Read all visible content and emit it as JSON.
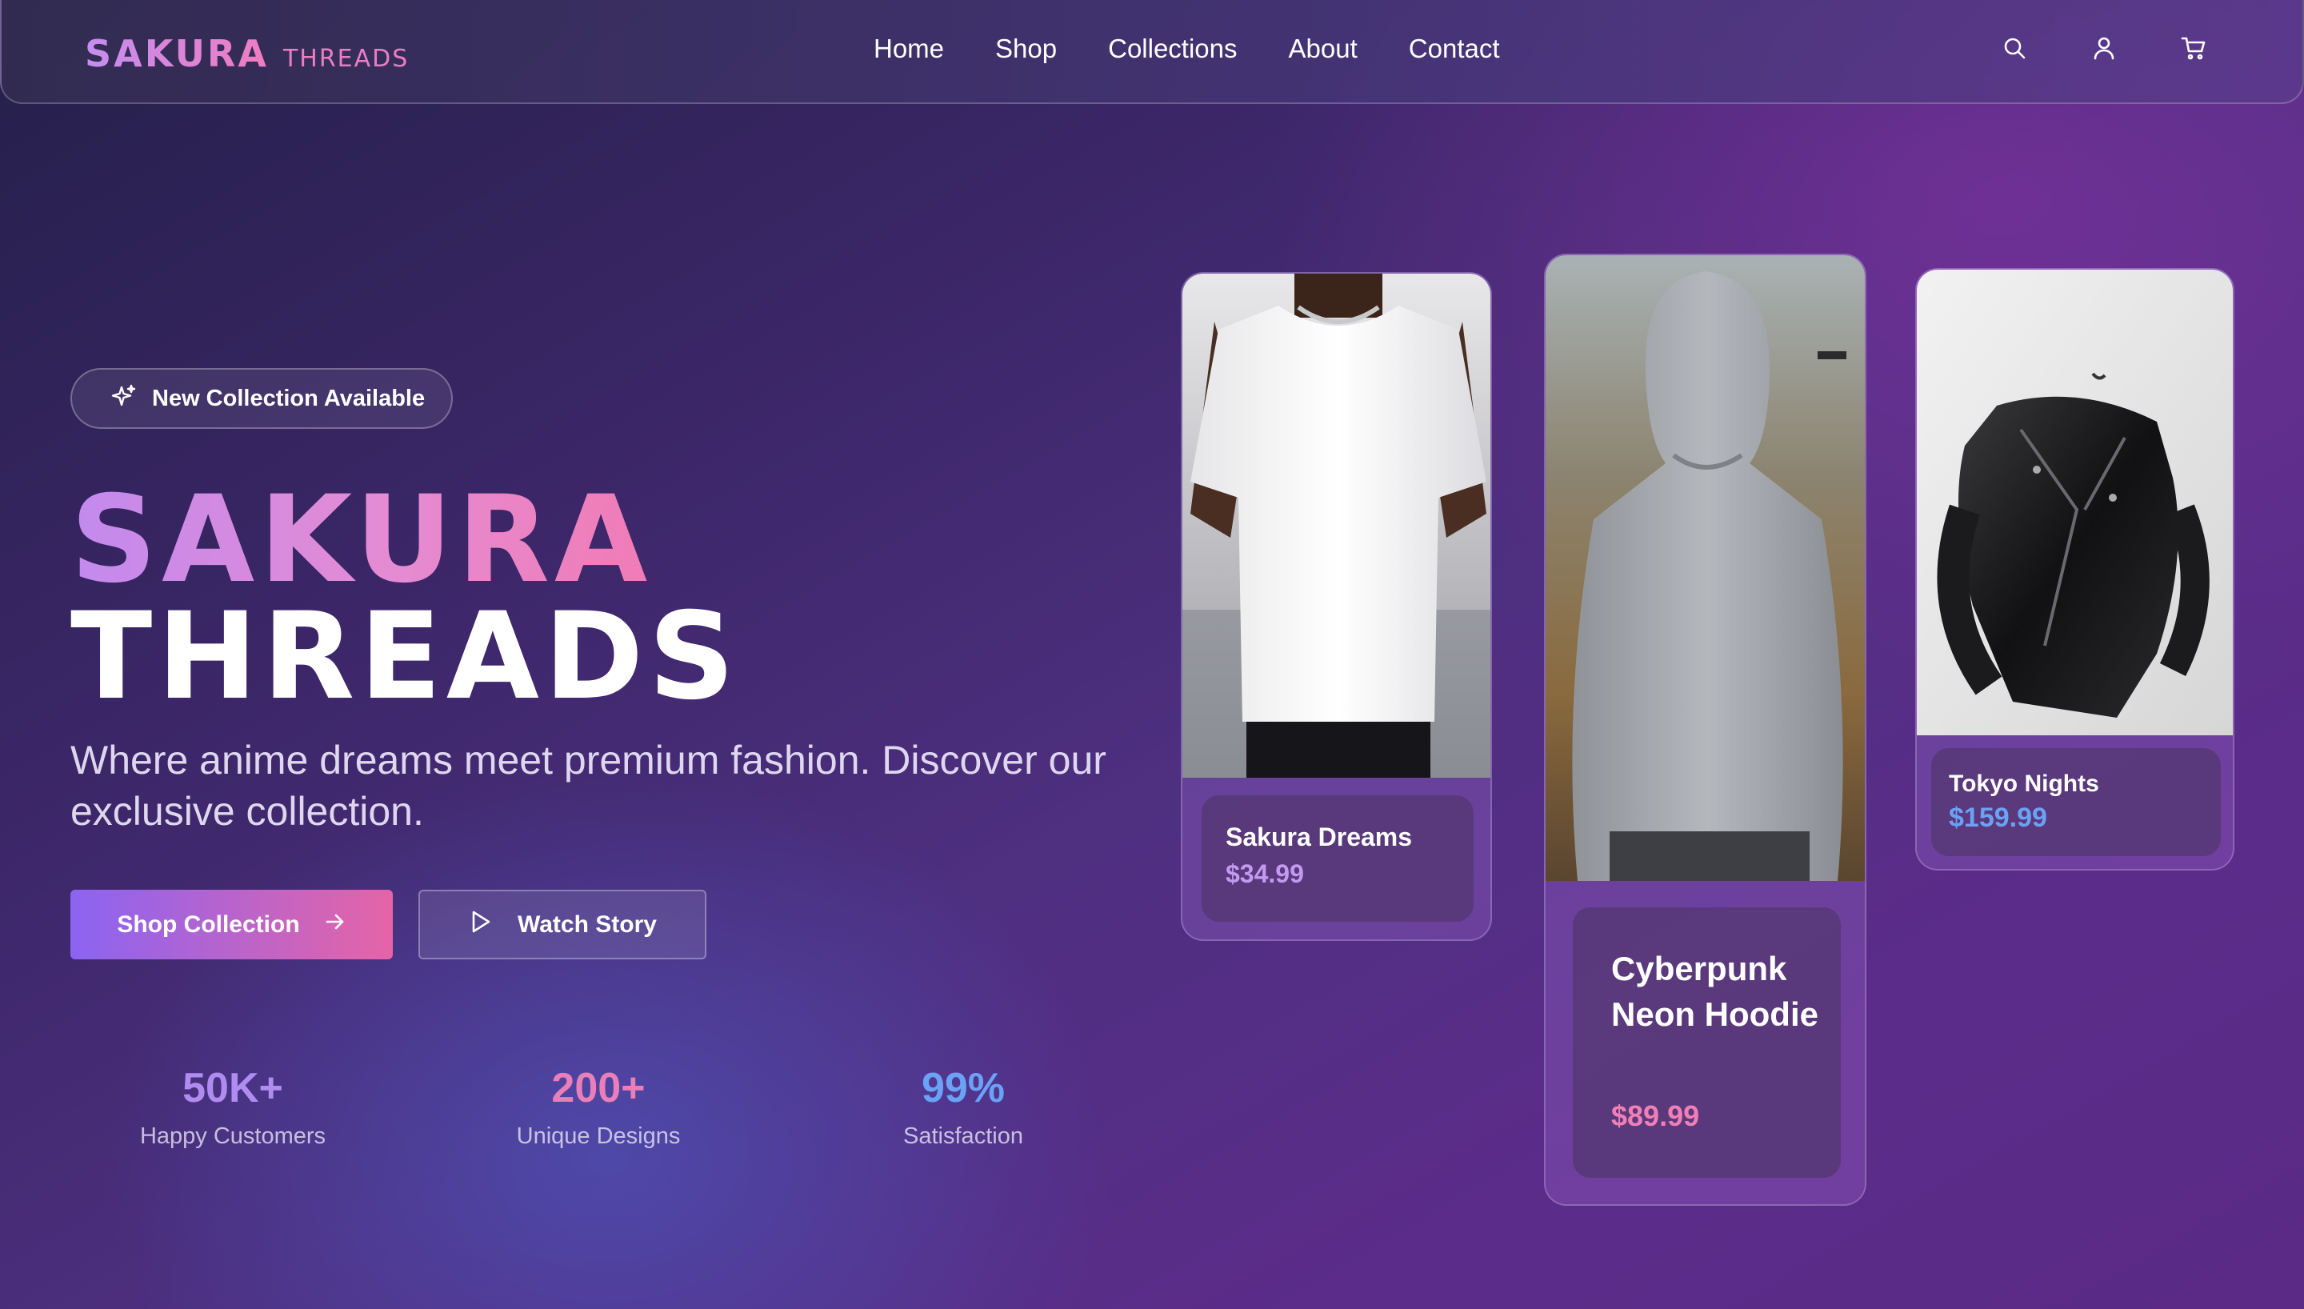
{
  "brand": {
    "main": "SAKURA",
    "sub": "THREADS"
  },
  "nav": {
    "items": [
      {
        "label": "Home"
      },
      {
        "label": "Shop"
      },
      {
        "label": "Collections"
      },
      {
        "label": "About"
      },
      {
        "label": "Contact"
      }
    ],
    "icons": [
      "search-icon",
      "user-icon",
      "cart-icon"
    ]
  },
  "hero": {
    "badge": "New Collection Available",
    "title_line1": "SAKURA",
    "title_line2": "THREADS",
    "tagline": "Where anime dreams meet premium fashion. Discover our exclusive collection.",
    "primary_button": "Shop Collection",
    "secondary_button": "Watch Story"
  },
  "stats": [
    {
      "value": "50K+",
      "label": "Happy Customers",
      "color": "#b08cf0"
    },
    {
      "value": "200+",
      "label": "Unique Designs",
      "color": "#e97eb8"
    },
    {
      "value": "99%",
      "label": "Satisfaction",
      "color": "#6aa2f5"
    }
  ],
  "products": [
    {
      "name": "Sakura Dreams",
      "price": "$34.99",
      "price_color": "#c39af0",
      "image": "white-tshirt-photo"
    },
    {
      "name": "Cyberpunk Neon Hoodie",
      "price": "$89.99",
      "price_color": "#f07fb5",
      "image": "grey-hoodie-photo"
    },
    {
      "name": "Tokyo Nights",
      "price": "$159.99",
      "price_color": "#6aa2f5",
      "image": "leather-jacket-photo"
    }
  ],
  "colors": {
    "accent_purple": "#8b64f2",
    "accent_pink": "#e564a6",
    "background": "#3b2667"
  }
}
